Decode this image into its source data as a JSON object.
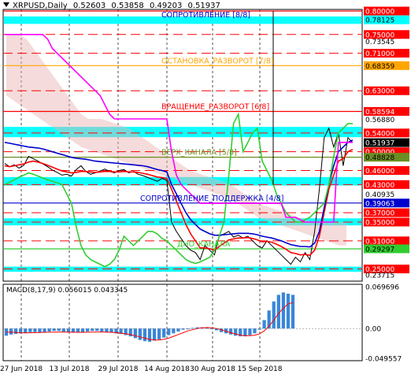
{
  "header": {
    "symbol": "XRPUSD,Daily",
    "open": "0.52603",
    "high": "0.53858",
    "low": "0.49203",
    "close": "0.51937"
  },
  "chart_data": {
    "type": "line",
    "price_panel": {
      "ylim": [
        0.2375,
        0.8
      ],
      "levels": [
        {
          "value": 0.8,
          "label": "0.80000",
          "color": "#ff0000",
          "style": "solid",
          "tag": "red"
        },
        {
          "value": 0.78125,
          "label": "0.78125",
          "color": "#00ffff",
          "style": "solid",
          "tag": "cyan"
        },
        {
          "value": 0.75,
          "label": "0.75000",
          "color": "#ff0000",
          "style": "dash",
          "tag": "red"
        },
        {
          "value": 0.73545,
          "label": "0.73545",
          "color": "#aaaaaa",
          "style": "none",
          "tag": "plain"
        },
        {
          "value": 0.71,
          "label": "0.71000",
          "color": "#ff0000",
          "style": "dash",
          "tag": "red"
        },
        {
          "value": 0.68359,
          "label": "0.68359",
          "color": "#ffa500",
          "style": "solid",
          "tag": "orange"
        },
        {
          "value": 0.63,
          "label": "0.63000",
          "color": "#ff0000",
          "style": "dash",
          "tag": "red"
        },
        {
          "value": 0.58594,
          "label": "0.58594",
          "color": "#ff0000",
          "style": "solid",
          "tag": "red"
        },
        {
          "value": 0.5688,
          "label": "0.56880",
          "color": "#aaaaaa",
          "style": "none",
          "tag": "plain"
        },
        {
          "value": 0.54,
          "label": "0.54000",
          "color": "#ff0000",
          "style": "dash",
          "tag": "red"
        },
        {
          "value": 0.51937,
          "label": "0.51937",
          "color": "#000000",
          "style": "none",
          "tag": "black"
        },
        {
          "value": 0.5,
          "label": "0.50000",
          "color": "#ff0000",
          "style": "dash",
          "tag": "red"
        },
        {
          "value": 0.48828,
          "label": "0.48828",
          "color": "#6b8e23",
          "style": "solid",
          "tag": "olive"
        },
        {
          "value": 0.46,
          "label": "0.46000",
          "color": "#ff0000",
          "style": "dash",
          "tag": "red"
        },
        {
          "value": 0.43,
          "label": "0.43000",
          "color": "#ff0000",
          "style": "dash",
          "tag": "red"
        },
        {
          "value": 0.40935,
          "label": "0.40935",
          "color": "#aaaaaa",
          "style": "none",
          "tag": "plain"
        },
        {
          "value": 0.39063,
          "label": "0.39063",
          "color": "#0000cd",
          "style": "solid",
          "tag": "blue"
        },
        {
          "value": 0.37,
          "label": "0.37000",
          "color": "#ff0000",
          "style": "dash",
          "tag": "red"
        },
        {
          "value": 0.35,
          "label": "0.35000",
          "color": "#ff0000",
          "style": "dash",
          "tag": "red"
        },
        {
          "value": 0.31,
          "label": "0.31000",
          "color": "#ff0000",
          "style": "dash",
          "tag": "red"
        },
        {
          "value": 0.29297,
          "label": "0.29297",
          "color": "#32cd32",
          "style": "solid",
          "tag": "green"
        },
        {
          "value": 0.25,
          "label": "0.25000",
          "color": "#ff0000",
          "style": "dash",
          "tag": "red"
        },
        {
          "value": 0.23715,
          "label": "0.23715",
          "color": "#aaaaaa",
          "style": "none",
          "tag": "plain"
        }
      ],
      "cyan_bands": [
        [
          0.7725,
          0.7885
        ],
        [
          0.531,
          0.553
        ],
        [
          0.428,
          0.446
        ],
        [
          0.343,
          0.358
        ],
        [
          0.244,
          0.255
        ]
      ],
      "annotations": [
        {
          "text": "СОПРОТИВЛЕНИЕ [8/8]",
          "value": 0.78125,
          "color": "#0000cd"
        },
        {
          "text": "ОСТАНОВКА_РАЗВОРОТ [7/8]",
          "value": 0.68359,
          "color": "#ffa500"
        },
        {
          "text": "ВРАЩЕНИЕ_РАЗВОРОТ [6/8]",
          "value": 0.58594,
          "color": "#ff0000"
        },
        {
          "text": "ВЕРХ_КАНАЛА [5/8]",
          "value": 0.48828,
          "color": "#6b8e23"
        },
        {
          "text": "СОПРОТИВЛЕНИЕ_ПОДДЕРЖКА [4/8]",
          "value": 0.39063,
          "color": "#0000cd"
        },
        {
          "text": "ДНО_КАНАЛА",
          "value": 0.29297,
          "color": "#32cd32"
        }
      ],
      "series": [
        {
          "name": "price",
          "color": "#000000",
          "values": [
            0.475,
            0.468,
            0.472,
            0.465,
            0.471,
            0.49,
            0.485,
            0.48,
            0.474,
            0.468,
            0.461,
            0.456,
            0.45,
            0.452,
            0.448,
            0.462,
            0.47,
            0.458,
            0.452,
            0.455,
            0.459,
            0.463,
            0.458,
            0.455,
            0.46,
            0.462,
            0.455,
            0.458,
            0.452,
            0.449,
            0.445,
            0.441,
            0.437,
            0.443,
            0.439,
            0.35,
            0.33,
            0.315,
            0.3,
            0.29,
            0.285,
            0.27,
            0.3,
            0.29,
            0.28,
            0.32,
            0.325,
            0.33,
            0.318,
            0.322,
            0.316,
            0.32,
            0.31,
            0.3,
            0.295,
            0.31,
            0.3,
            0.29,
            0.28,
            0.27,
            0.26,
            0.275,
            0.265,
            0.285,
            0.27,
            0.33,
            0.42,
            0.53,
            0.55,
            0.51,
            0.54,
            0.47,
            0.53,
            0.51937
          ]
        },
        {
          "name": "",
          "color": "#ff0000",
          "values": [
            0.47,
            0.468,
            0.47,
            0.472,
            0.474,
            0.478,
            0.48,
            0.478,
            0.475,
            0.471,
            0.467,
            0.463,
            0.459,
            0.457,
            0.455,
            0.456,
            0.458,
            0.458,
            0.457,
            0.456,
            0.457,
            0.458,
            0.458,
            0.457,
            0.457,
            0.458,
            0.457,
            0.457,
            0.456,
            0.454,
            0.452,
            0.449,
            0.446,
            0.445,
            0.443,
            0.42,
            0.395,
            0.37,
            0.345,
            0.325,
            0.31,
            0.295,
            0.295,
            0.293,
            0.29,
            0.298,
            0.305,
            0.312,
            0.314,
            0.316,
            0.316,
            0.317,
            0.315,
            0.312,
            0.308,
            0.309,
            0.307,
            0.303,
            0.298,
            0.292,
            0.285,
            0.283,
            0.28,
            0.281,
            0.279,
            0.29,
            0.32,
            0.37,
            0.42,
            0.45,
            0.48,
            0.485,
            0.5,
            0.505
          ]
        },
        {
          "name": "",
          "color": "#0000cd",
          "values": [
            0.52,
            0.518,
            0.516,
            0.514,
            0.512,
            0.51,
            0.509,
            0.508,
            0.506,
            0.503,
            0.5,
            0.497,
            0.494,
            0.491,
            0.488,
            0.486,
            0.485,
            0.484,
            0.482,
            0.48,
            0.479,
            0.478,
            0.477,
            0.476,
            0.475,
            0.474,
            0.473,
            0.472,
            0.471,
            0.47,
            0.468,
            0.465,
            0.462,
            0.46,
            0.457,
            0.43,
            0.41,
            0.39,
            0.37,
            0.355,
            0.345,
            0.335,
            0.33,
            0.325,
            0.322,
            0.322,
            0.323,
            0.324,
            0.325,
            0.326,
            0.326,
            0.326,
            0.325,
            0.323,
            0.32,
            0.318,
            0.316,
            0.313,
            0.31,
            0.306,
            0.302,
            0.3,
            0.298,
            0.298,
            0.297,
            0.305,
            0.33,
            0.38,
            0.43,
            0.47,
            0.5,
            0.51,
            0.52,
            0.525
          ]
        },
        {
          "name": "",
          "color": "#32cd32",
          "values": [
            0.43,
            0.435,
            0.44,
            0.446,
            0.45,
            0.455,
            0.452,
            0.448,
            0.444,
            0.44,
            0.437,
            0.434,
            0.43,
            0.41,
            0.39,
            0.34,
            0.3,
            0.28,
            0.27,
            0.265,
            0.26,
            0.255,
            0.26,
            0.27,
            0.29,
            0.32,
            0.31,
            0.3,
            0.31,
            0.32,
            0.33,
            0.33,
            0.325,
            0.315,
            0.31,
            0.3,
            0.29,
            0.28,
            0.27,
            0.265,
            0.262,
            0.265,
            0.27,
            0.275,
            0.29,
            0.32,
            0.35,
            0.45,
            0.56,
            0.58,
            0.5,
            0.52,
            0.54,
            0.55,
            0.48,
            0.46,
            0.44,
            0.41,
            0.39,
            0.37,
            0.36,
            0.35,
            0.35,
            0.355,
            0.36,
            0.37,
            0.38,
            0.39,
            0.43,
            0.49,
            0.54,
            0.55,
            0.56,
            0.56
          ]
        },
        {
          "name": "",
          "color": "#ff00ff",
          "values": [
            0.75,
            0.75,
            0.75,
            0.75,
            0.75,
            0.75,
            0.75,
            0.75,
            0.75,
            0.74,
            0.72,
            0.71,
            0.7,
            0.69,
            0.68,
            0.67,
            0.66,
            0.65,
            0.64,
            0.63,
            0.62,
            0.6,
            0.58,
            0.57,
            0.57,
            0.57,
            0.57,
            0.57,
            0.57,
            0.57,
            0.57,
            0.57,
            0.57,
            0.57,
            0.57,
            0.5,
            0.45,
            0.43,
            0.42,
            0.41,
            0.4,
            0.39,
            0.39,
            0.39,
            0.39,
            0.39,
            0.39,
            0.39,
            0.39,
            0.39,
            0.39,
            0.39,
            0.39,
            0.39,
            0.39,
            0.39,
            0.39,
            0.39,
            0.39,
            0.36,
            0.36,
            0.36,
            0.355,
            0.35,
            0.35,
            0.35,
            0.35,
            0.35,
            0.35,
            0.35,
            0.52,
            0.52,
            0.52,
            0.52
          ]
        }
      ],
      "ichimoku_cloud": {
        "color": "#e8b0b0",
        "upper": [
          0.75,
          0.75,
          0.75,
          0.74,
          0.72,
          0.7,
          0.68,
          0.66,
          0.64,
          0.62,
          0.6,
          0.58,
          0.57,
          0.57,
          0.57,
          0.565,
          0.56,
          0.555,
          0.55,
          0.54,
          0.53,
          0.52,
          0.51,
          0.5,
          0.49,
          0.48,
          0.47,
          0.46,
          0.455,
          0.45,
          0.445,
          0.44,
          0.435,
          0.43,
          0.42,
          0.41,
          0.4,
          0.39,
          0.385,
          0.38,
          0.375,
          0.37,
          0.365,
          0.36,
          0.355,
          0.35,
          0.35,
          0.35,
          0.35,
          0.35,
          0.35
        ],
        "lower": [
          0.62,
          0.61,
          0.6,
          0.59,
          0.58,
          0.57,
          0.56,
          0.55,
          0.54,
          0.53,
          0.52,
          0.51,
          0.505,
          0.5,
          0.495,
          0.49,
          0.485,
          0.48,
          0.475,
          0.47,
          0.465,
          0.46,
          0.455,
          0.45,
          0.445,
          0.44,
          0.435,
          0.43,
          0.425,
          0.42,
          0.415,
          0.41,
          0.405,
          0.4,
          0.39,
          0.38,
          0.37,
          0.36,
          0.355,
          0.35,
          0.345,
          0.34,
          0.335,
          0.33,
          0.325,
          0.32,
          0.315,
          0.31,
          0.305,
          0.3,
          0.3
        ]
      }
    },
    "macd_panel": {
      "title": "MACD(8,17,9) 0.056015 0.043345",
      "ylim": [
        -0.04957,
        0.06965
      ],
      "ticks": [
        {
          "value": 0.069696,
          "label": "0.069696"
        },
        {
          "value": 0.0,
          "label": "0.00"
        },
        {
          "value": -0.049557,
          "label": "-0.049557"
        }
      ],
      "histogram": [
        -0.012,
        -0.01,
        -0.009,
        -0.008,
        -0.007,
        -0.006,
        -0.006,
        -0.007,
        -0.006,
        -0.005,
        -0.004,
        -0.004,
        -0.005,
        -0.006,
        -0.007,
        -0.007,
        -0.006,
        -0.005,
        -0.004,
        -0.004,
        -0.005,
        -0.006,
        -0.007,
        -0.008,
        -0.009,
        -0.011,
        -0.013,
        -0.016,
        -0.019,
        -0.021,
        -0.022,
        -0.02,
        -0.018,
        -0.015,
        -0.011,
        -0.008,
        -0.005,
        -0.002,
        0.0,
        0.001,
        0.002,
        0.002,
        0.001,
        0.0,
        -0.003,
        -0.006,
        -0.008,
        -0.01,
        -0.012,
        -0.013,
        -0.013,
        -0.011,
        -0.008,
        -0.002,
        0.014,
        0.03,
        0.045,
        0.056,
        0.06,
        0.058,
        0.056
      ],
      "signal": [
        -0.006,
        -0.006,
        -0.0065,
        -0.007,
        -0.0072,
        -0.007,
        -0.0068,
        -0.0066,
        -0.0064,
        -0.0062,
        -0.006,
        -0.0058,
        -0.0058,
        -0.006,
        -0.0062,
        -0.0064,
        -0.0064,
        -0.0062,
        -0.006,
        -0.0058,
        -0.0058,
        -0.006,
        -0.0064,
        -0.007,
        -0.0078,
        -0.0088,
        -0.0102,
        -0.012,
        -0.014,
        -0.016,
        -0.018,
        -0.019,
        -0.019,
        -0.018,
        -0.016,
        -0.013,
        -0.01,
        -0.007,
        -0.004,
        -0.002,
        0.0,
        0.0012,
        0.0016,
        0.0012,
        0.0,
        -0.002,
        -0.0045,
        -0.007,
        -0.009,
        -0.011,
        -0.012,
        -0.012,
        -0.011,
        -0.009,
        -0.004,
        0.004,
        0.014,
        0.025,
        0.034,
        0.041,
        0.0433
      ]
    },
    "x_ticks": [
      "27 Jun 2018",
      "13 Jul 2018",
      "29 Jul 2018",
      "14 Aug 2018",
      "30 Aug 2018",
      "15 Sep 2018"
    ]
  }
}
